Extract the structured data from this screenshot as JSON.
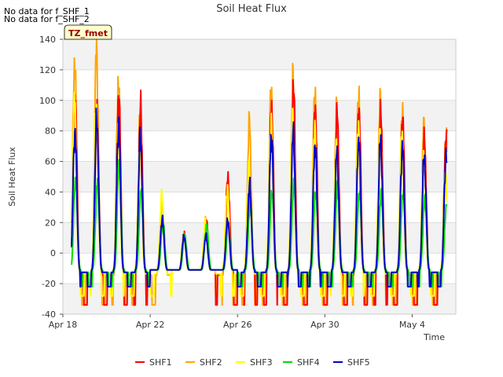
{
  "notes": [
    "No data for f_SHF_1",
    "No data for f_SHF_2"
  ],
  "chart_data": {
    "type": "line",
    "title": "Soil Heat Flux",
    "xlabel": "Time",
    "ylabel": "Soil Heat Flux",
    "site_label": "TZ_fmet",
    "x_range_days": [
      0,
      18
    ],
    "xticks": [
      {
        "day": 0,
        "label": "Apr 18"
      },
      {
        "day": 4,
        "label": "Apr 22"
      },
      {
        "day": 8,
        "label": "Apr 26"
      },
      {
        "day": 12,
        "label": "Apr 30"
      },
      {
        "day": 16,
        "label": "May 4"
      }
    ],
    "ylim": [
      -40,
      140
    ],
    "yticks": [
      -40,
      -20,
      0,
      20,
      40,
      60,
      80,
      100,
      120,
      140
    ],
    "grid": true,
    "legend_position": "bottom",
    "series": [
      {
        "name": "SHF1",
        "color": "#ff0000",
        "peaks": [
          105,
          88,
          105,
          94,
          22,
          12,
          22,
          49,
          43,
          96,
          107,
          96,
          90,
          96,
          90,
          90,
          73,
          79
        ],
        "nightmin": -34
      },
      {
        "name": "SHF2",
        "color": "#ffa500",
        "peaks": [
          126,
          133,
          113,
          91,
          32,
          12,
          22,
          43,
          85,
          109,
          113,
          106,
          93,
          104,
          100,
          92,
          85,
          76
        ],
        "nightmin": -34
      },
      {
        "name": "SHF3",
        "color": "#ffff00",
        "peaks": [
          100,
          96,
          78,
          70,
          37,
          12,
          20,
          42,
          55,
          85,
          87,
          80,
          70,
          80,
          78,
          75,
          65,
          50
        ],
        "nightmin": -28
      },
      {
        "name": "SHF4",
        "color": "#00dd00",
        "peaks": [
          48,
          45,
          60,
          40,
          20,
          12,
          18,
          18,
          32,
          40,
          45,
          40,
          43,
          40,
          38,
          40,
          35,
          34
        ],
        "nightmin": -22
      },
      {
        "name": "SHF5",
        "color": "#0000cc",
        "peaks": [
          80,
          87,
          84,
          76,
          22,
          11,
          11,
          22,
          44,
          78,
          78,
          72,
          65,
          75,
          74,
          70,
          63,
          63
        ],
        "nightmin": -22
      }
    ]
  }
}
